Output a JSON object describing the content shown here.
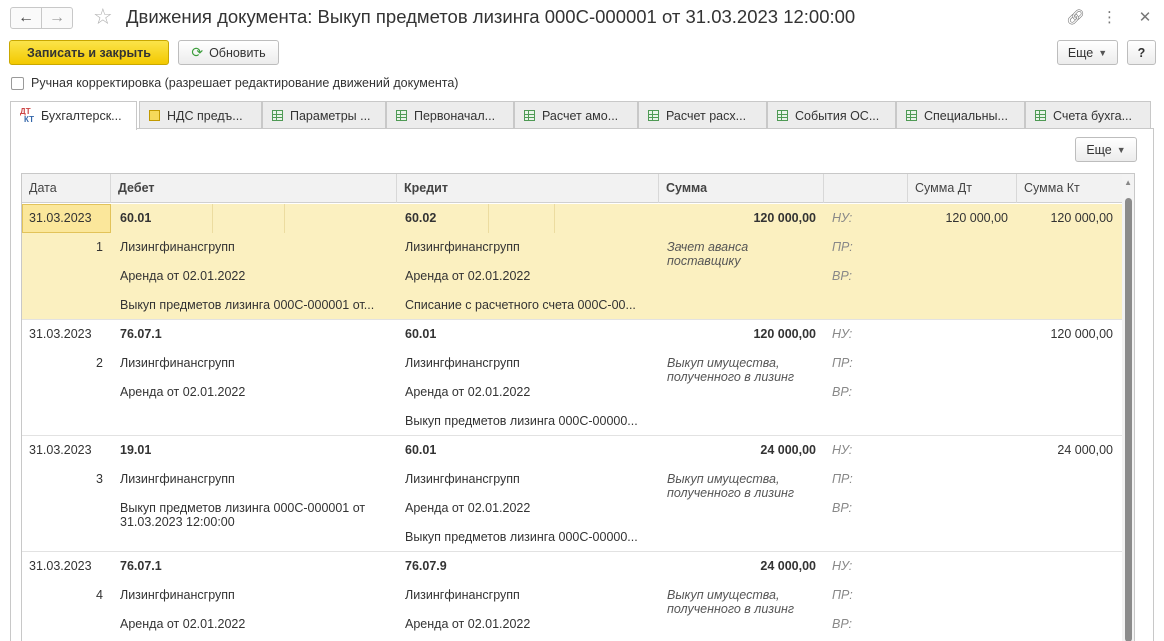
{
  "window": {
    "title": "Движения документа: Выкуп предметов лизинга 000С-000001 от 31.03.2023 12:00:00",
    "back_icon": "arrow-left",
    "forward_icon": "arrow-right",
    "star_icon": "star",
    "link_icon": "link",
    "menu_icon": "kebab",
    "close_icon": "close"
  },
  "toolbar": {
    "save_close": "Записать и закрыть",
    "refresh": "Обновить",
    "more": "Еще",
    "help": "?"
  },
  "manual_adjust": {
    "label": "Ручная корректировка (разрешает редактирование движений документа)",
    "checked": false
  },
  "tabs": [
    {
      "label": "Бухгалтерск...",
      "icon": "dt-kt",
      "active": true
    },
    {
      "label": "НДС предъ...",
      "icon": "register-yellow"
    },
    {
      "label": "Параметры ...",
      "icon": "table"
    },
    {
      "label": "Первоначал...",
      "icon": "table"
    },
    {
      "label": "Расчет амо...",
      "icon": "table"
    },
    {
      "label": "Расчет расх...",
      "icon": "table"
    },
    {
      "label": "События ОС...",
      "icon": "table"
    },
    {
      "label": "Специальны...",
      "icon": "table"
    },
    {
      "label": "Счета бухга...",
      "icon": "table"
    }
  ],
  "panel": {
    "more": "Еще"
  },
  "table": {
    "columns": [
      "Дата",
      "Дебет",
      "Кредит",
      "Сумма",
      "",
      "Сумма Дт",
      "Сумма Кт"
    ],
    "rows": [
      {
        "date": "31.03.2023",
        "num": "1",
        "selected": true,
        "debit": [
          "60.01",
          "Лизингфинансгрупп",
          "Аренда от 02.01.2022",
          "Выкуп предметов лизинга 000С-000001 от..."
        ],
        "credit": [
          "60.02",
          "Лизингфинансгрупп",
          "Аренда от 02.01.2022",
          "Списание с расчетного счета 000С-00..."
        ],
        "sum": "120 000,00",
        "content": "Зачет аванса поставщику",
        "nu": "НУ:",
        "pr": "ПР:",
        "vr": "ВР:",
        "sum_dt": "120 000,00",
        "sum_kt": "120 000,00"
      },
      {
        "date": "31.03.2023",
        "num": "2",
        "selected": false,
        "debit": [
          "76.07.1",
          "Лизингфинансгрупп",
          "Аренда от 02.01.2022",
          ""
        ],
        "credit": [
          "60.01",
          "Лизингфинансгрупп",
          "Аренда от 02.01.2022",
          "Выкуп предметов лизинга 000С-00000..."
        ],
        "sum": "120 000,00",
        "content": "Выкуп имущества, полученного в лизинг",
        "nu": "НУ:",
        "pr": "ПР:",
        "vr": "ВР:",
        "sum_dt": "",
        "sum_kt": "120 000,00"
      },
      {
        "date": "31.03.2023",
        "num": "3",
        "selected": false,
        "debit": [
          "19.01",
          "Лизингфинансгрупп",
          "Выкуп предметов лизинга 000С-000001 от 31.03.2023 12:00:00",
          ""
        ],
        "credit": [
          "60.01",
          "Лизингфинансгрупп",
          "Аренда от 02.01.2022",
          "Выкуп предметов лизинга 000С-00000..."
        ],
        "sum": "24 000,00",
        "content": "Выкуп имущества, полученного в лизинг",
        "nu": "НУ:",
        "pr": "ПР:",
        "vr": "ВР:",
        "sum_dt": "",
        "sum_kt": "24 000,00"
      },
      {
        "date": "31.03.2023",
        "num": "4",
        "selected": false,
        "debit": [
          "76.07.1",
          "Лизингфинансгрупп",
          "Аренда от 02.01.2022",
          ""
        ],
        "credit": [
          "76.07.9",
          "Лизингфинансгрупп",
          "Аренда от 02.01.2022",
          ""
        ],
        "sum": "24 000,00",
        "content": "Выкуп имущества, полученного в лизинг",
        "nu": "НУ:",
        "pr": "ПР:",
        "vr": "ВР:",
        "sum_dt": "",
        "sum_kt": ""
      }
    ]
  }
}
